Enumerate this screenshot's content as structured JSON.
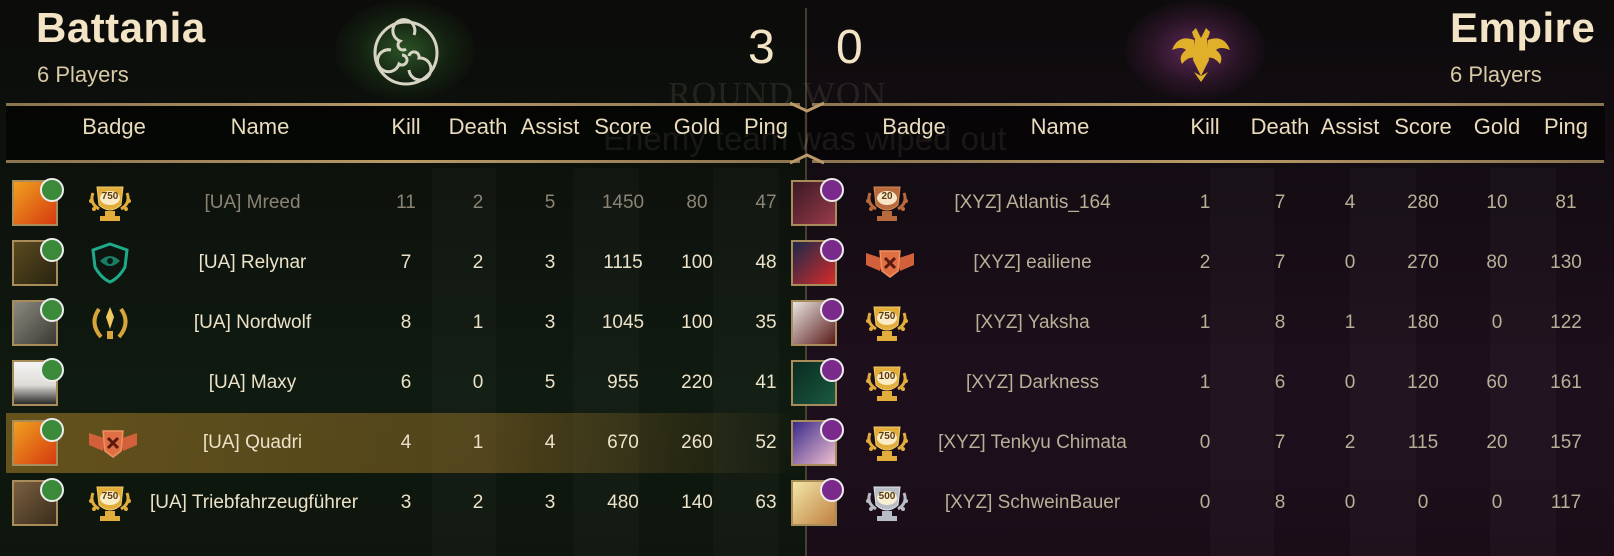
{
  "left_team": {
    "name": "Battania",
    "players_label": "6 Players",
    "score": "3",
    "emblem": "triskelion-icon",
    "color": "#2f6a2a"
  },
  "right_team": {
    "name": "Empire",
    "players_label": "6 Players",
    "score": "0",
    "emblem": "double-headed-eagle-icon",
    "color": "#7a2a6a"
  },
  "overlay": {
    "round_text": "ROUND WON",
    "wipe_text": "Enemy team was wiped out"
  },
  "columns": [
    "Badge",
    "Name",
    "Kill",
    "Death",
    "Assist",
    "Score",
    "Gold",
    "Ping"
  ],
  "left_players": [
    {
      "name": "[UA] Mreed",
      "kill": "11",
      "death": "2",
      "assist": "5",
      "score": "1450",
      "gold": "80",
      "ping": "47",
      "badge": "trophy-750",
      "badge_text": "750",
      "avatar": "skull-avatar",
      "dead": true
    },
    {
      "name": "[UA] Relynar",
      "kill": "7",
      "death": "2",
      "assist": "3",
      "score": "1115",
      "gold": "100",
      "ping": "48",
      "badge": "shield-badge",
      "badge_text": "",
      "avatar": "knight-avatar",
      "dead": false
    },
    {
      "name": "[UA] Nordwolf",
      "kill": "8",
      "death": "1",
      "assist": "3",
      "score": "1045",
      "gold": "100",
      "ping": "35",
      "badge": "laurel-badge",
      "badge_text": "",
      "avatar": "portrait-avatar",
      "dead": false
    },
    {
      "name": "[UA] Maxy",
      "kill": "6",
      "death": "0",
      "assist": "5",
      "score": "955",
      "gold": "220",
      "ping": "41",
      "badge": "",
      "badge_text": "",
      "avatar": "man-avatar",
      "dead": false
    },
    {
      "name": "[UA] Quadri",
      "kill": "4",
      "death": "1",
      "assist": "4",
      "score": "670",
      "gold": "260",
      "ping": "52",
      "badge": "banner-badge",
      "badge_text": "",
      "avatar": "skull-avatar",
      "dead": false,
      "highlight": true
    },
    {
      "name": "[UA] Triebfahrzeugführer",
      "kill": "3",
      "death": "2",
      "assist": "3",
      "score": "480",
      "gold": "140",
      "ping": "63",
      "badge": "trophy-750",
      "badge_text": "750",
      "avatar": "soldier-avatar",
      "dead": false
    }
  ],
  "right_players": [
    {
      "name": "[XYZ] Atlantis_164",
      "kill": "1",
      "death": "7",
      "assist": "4",
      "score": "280",
      "gold": "10",
      "ping": "81",
      "badge": "trophy-bronze-20",
      "badge_text": "20",
      "avatar": "anime-avatar"
    },
    {
      "name": "[XYZ] eailiene",
      "kill": "2",
      "death": "7",
      "assist": "0",
      "score": "270",
      "gold": "80",
      "ping": "130",
      "badge": "banner-badge",
      "badge_text": "",
      "avatar": "creature-avatar"
    },
    {
      "name": "[XYZ] Yaksha",
      "kill": "1",
      "death": "8",
      "assist": "1",
      "score": "180",
      "gold": "0",
      "ping": "122",
      "badge": "trophy-750",
      "badge_text": "750",
      "avatar": "mask-avatar"
    },
    {
      "name": "[XYZ] Darkness",
      "kill": "1",
      "death": "6",
      "assist": "0",
      "score": "120",
      "gold": "60",
      "ping": "161",
      "badge": "trophy-100",
      "badge_text": "100",
      "avatar": "dark-avatar"
    },
    {
      "name": "[XYZ] Tenkyu Chimata",
      "kill": "0",
      "death": "7",
      "assist": "2",
      "score": "115",
      "gold": "20",
      "ping": "157",
      "badge": "trophy-750",
      "badge_text": "750",
      "avatar": "anime-avatar-2"
    },
    {
      "name": "[XYZ] SchweinBauer",
      "kill": "0",
      "death": "8",
      "assist": "0",
      "score": "0",
      "gold": "0",
      "ping": "117",
      "badge": "trophy-silver-500",
      "badge_text": "500",
      "avatar": "mouse-avatar"
    }
  ]
}
